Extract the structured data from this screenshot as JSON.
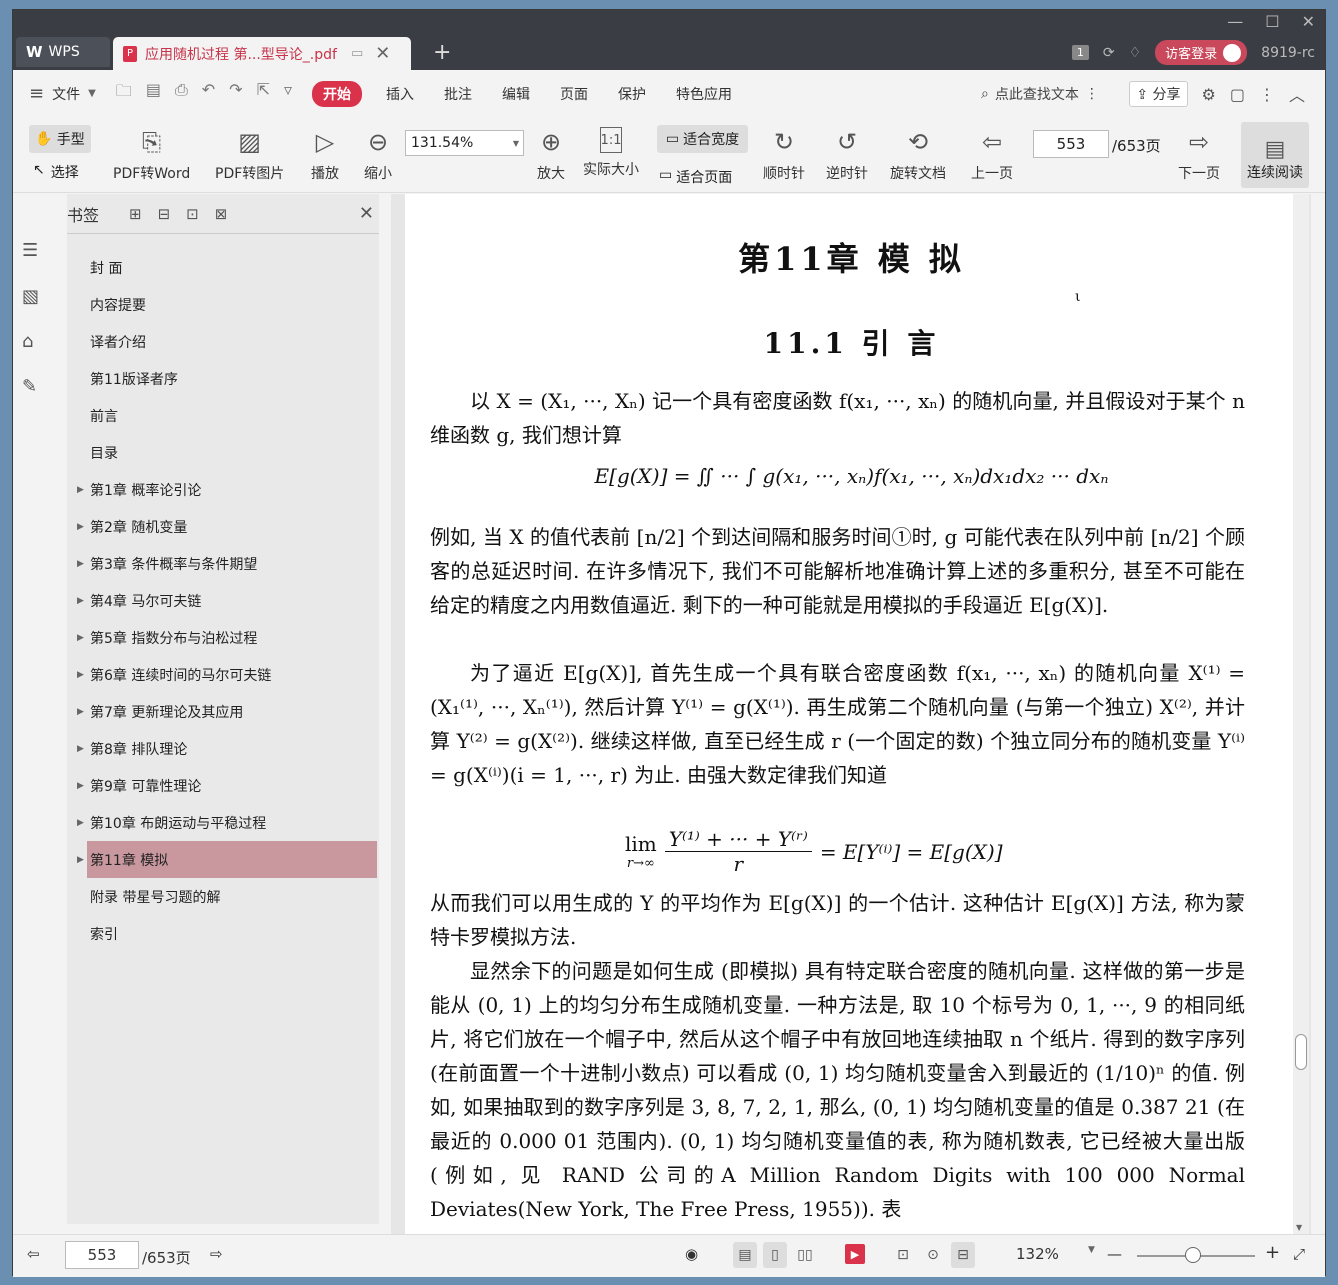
{
  "titlebar": {
    "app_name": "WPS",
    "doc_tab_title": "应用随机过程 第...型导论_.pdf",
    "page_count_badge": "1",
    "login_label": "访客登录",
    "user_suffix": "8919-rc"
  },
  "menubar": {
    "file": "文件",
    "tabs": [
      "开始",
      "插入",
      "批注",
      "编辑",
      "页面",
      "保护",
      "特色应用"
    ],
    "search_label": "点此查找文本",
    "share_label": "分享"
  },
  "toolbar": {
    "hand_tool": "手型",
    "select_tool": "选择",
    "pdf_to_word": "PDF转Word",
    "pdf_to_image": "PDF转图片",
    "play": "播放",
    "zoom_out": "缩小",
    "zoom_value": "131.54%",
    "zoom_in": "放大",
    "actual_size": "实际大小",
    "fit_width": "适合宽度",
    "fit_page": "适合页面",
    "clockwise": "顺时针",
    "counterclockwise": "逆时针",
    "rotate_doc": "旋转文档",
    "prev_page": "上一页",
    "page_input": "553",
    "page_total": "/653页",
    "next_page": "下一页",
    "continuous": "连续阅读"
  },
  "bookmarks": {
    "header": "书签",
    "items": [
      {
        "label": "封 面",
        "expandable": false,
        "active": false
      },
      {
        "label": "内容提要",
        "expandable": false,
        "active": false
      },
      {
        "label": "译者介绍",
        "expandable": false,
        "active": false
      },
      {
        "label": "第11版译者序",
        "expandable": false,
        "active": false
      },
      {
        "label": "前言",
        "expandable": false,
        "active": false
      },
      {
        "label": "目录",
        "expandable": false,
        "active": false
      },
      {
        "label": "第1章  概率论引论",
        "expandable": true,
        "active": false
      },
      {
        "label": "第2章  随机变量",
        "expandable": true,
        "active": false
      },
      {
        "label": "第3章  条件概率与条件期望",
        "expandable": true,
        "active": false
      },
      {
        "label": "第4章  马尔可夫链",
        "expandable": true,
        "active": false
      },
      {
        "label": "第5章  指数分布与泊松过程",
        "expandable": true,
        "active": false
      },
      {
        "label": "第6章  连续时间的马尔可夫链",
        "expandable": true,
        "active": false
      },
      {
        "label": "第7章  更新理论及其应用",
        "expandable": true,
        "active": false
      },
      {
        "label": "第8章  排队理论",
        "expandable": true,
        "active": false
      },
      {
        "label": "第9章  可靠性理论",
        "expandable": true,
        "active": false
      },
      {
        "label": "第10章  布朗运动与平稳过程",
        "expandable": true,
        "active": false
      },
      {
        "label": "第11章  模拟",
        "expandable": true,
        "active": true
      },
      {
        "label": "附录  带星号习题的解",
        "expandable": false,
        "active": false
      },
      {
        "label": "索引",
        "expandable": false,
        "active": false
      }
    ]
  },
  "page": {
    "chapter_title": "第11章   模      拟",
    "section_title": "11.1   引      言",
    "p1": "以 X = (X₁, ···, Xₙ) 记一个具有密度函数 f(x₁, ···, xₙ) 的随机向量, 并且假设对于某个 n 维函数 g, 我们想计算",
    "f1": "E[g(X)] = ∬ ··· ∫ g(x₁, ···, xₙ)f(x₁, ···, xₙ)dx₁dx₂ ··· dxₙ",
    "p2": "例如, 当 X 的值代表前 [n/2] 个到达间隔和服务时间①时, g 可能代表在队列中前 [n/2] 个顾客的总延迟时间. 在许多情况下, 我们不可能解析地准确计算上述的多重积分, 甚至不可能在给定的精度之内用数值逼近. 剩下的一种可能就是用模拟的手段逼近 E[g(X)].",
    "p3": "为了逼近 E[g(X)], 首先生成一个具有联合密度函数 f(x₁, ···, xₙ) 的随机向量 X⁽¹⁾ = (X₁⁽¹⁾, ···, Xₙ⁽¹⁾), 然后计算 Y⁽¹⁾ = g(X⁽¹⁾). 再生成第二个随机向量 (与第一个独立) X⁽²⁾, 并计算 Y⁽²⁾ = g(X⁽²⁾). 继续这样做, 直至已经生成 r (一个固定的数) 个独立同分布的随机变量 Y⁽ⁱ⁾ = g(X⁽ⁱ⁾)(i = 1, ···, r) 为止. 由强大数定律我们知道",
    "f2_lim": "lim",
    "f2_sub": "r→∞",
    "f2_num": "Y⁽¹⁾ + ··· + Y⁽ʳ⁾",
    "f2_den": "r",
    "f2_rhs": "= E[Y⁽ⁱ⁾] = E[g(X)]",
    "p4": "从而我们可以用生成的 Y 的平均作为 E[g(X)] 的一个估计. 这种估计 E[g(X)] 方法, 称为蒙特卡罗模拟方法.",
    "p5": "显然余下的问题是如何生成 (即模拟) 具有特定联合密度的随机向量. 这样做的第一步是能从 (0, 1) 上的均匀分布生成随机变量. 一种方法是, 取 10 个标号为 0, 1, ···, 9 的相同纸片, 将它们放在一个帽子中, 然后从这个帽子中有放回地连续抽取 n 个纸片. 得到的数字序列 (在前面置一个十进制小数点) 可以看成 (0, 1) 均匀随机变量舍入到最近的 (1/10)ⁿ 的值. 例如, 如果抽取到的数字序列是 3, 8, 7, 2, 1, 那么, (0, 1) 均匀随机变量的值是 0.387 21 (在最近的 0.000 01 范围内). (0, 1) 均匀随机变量值的表, 称为随机数表, 它已经被大量出版 (例如, 见 RAND 公司的A Million Random Digits with 100 000 Normal Deviates(New York, The Free Press, 1955)). 表"
  },
  "statusbar": {
    "page_input": "553",
    "page_total": "/653页",
    "zoom": "132%"
  },
  "colors": {
    "accent": "#d9324a",
    "active_bookmark": "#c9989f",
    "titlebar": "#3a3d44"
  }
}
